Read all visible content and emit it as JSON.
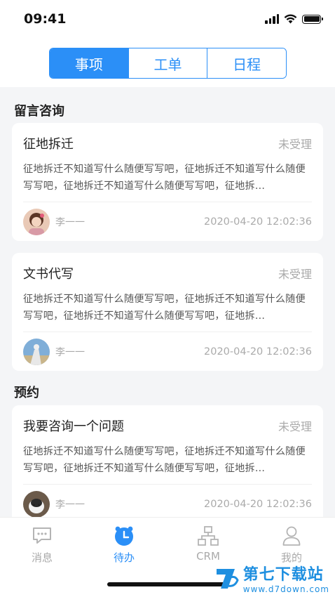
{
  "status_bar": {
    "time": "09:41"
  },
  "segmented": {
    "tabs": [
      {
        "label": "事项",
        "active": true
      },
      {
        "label": "工单",
        "active": false
      },
      {
        "label": "日程",
        "active": false
      }
    ]
  },
  "sections": {
    "consult": {
      "title": "留言咨询"
    },
    "appointment": {
      "title": "预约"
    }
  },
  "cards": [
    {
      "title": "征地拆迁",
      "status": "未受理",
      "body": "征地拆迁不知道写什么随便写写吧，征地拆迁不知道写什么随便写写吧，征地拆迁不知道写什么随便写写吧，征地拆...",
      "author": "李一一",
      "time": "2020-04-20 12:02:36"
    },
    {
      "title": "文书代写",
      "status": "未受理",
      "body": "征地拆迁不知道写什么随便写写吧，征地拆迁不知道写什么随便写写吧，征地拆迁不知道写什么随便写写吧，征地拆...",
      "author": "李一一",
      "time": "2020-04-20 12:02:36"
    },
    {
      "title": "我要咨询一个问题",
      "status": "未受理",
      "body": "征地拆迁不知道写什么随便写写吧，征地拆迁不知道写什么随便写写吧，征地拆迁不知道写什么随便写写吧，征地拆...",
      "author": "李一一",
      "time": "2020-04-20 12:02:36"
    }
  ],
  "tabbar": {
    "items": [
      {
        "label": "消息",
        "icon": "message-icon",
        "active": false
      },
      {
        "label": "待办",
        "icon": "clock-icon",
        "active": true
      },
      {
        "label": "CRM",
        "icon": "org-chart-icon",
        "active": false
      },
      {
        "label": "我的",
        "icon": "user-icon",
        "active": false
      }
    ]
  },
  "watermark": {
    "name": "第七下载站",
    "url": "www.d7down.com"
  },
  "colors": {
    "accent": "#2b8ff7",
    "muted": "#aaaaaa",
    "background": "#f4f5f7"
  }
}
